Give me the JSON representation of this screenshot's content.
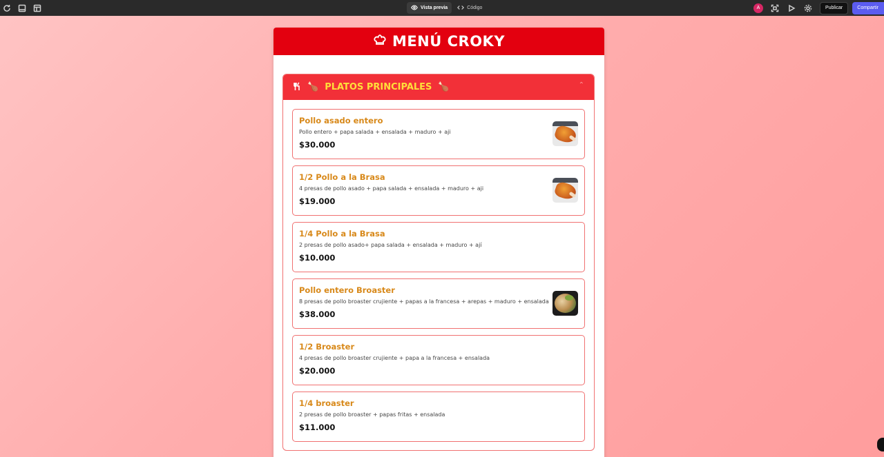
{
  "editor": {
    "tabs": [
      {
        "label": "Vista previa",
        "icon": "eye-icon"
      },
      {
        "label": "Código",
        "icon": "code-icon"
      }
    ],
    "avatar_initial": "A",
    "publish_label": "Publicar",
    "share_label": "Compartir"
  },
  "menu": {
    "title": "MENÚ CROKY",
    "section_title": "PLATOS PRINCIPALES",
    "colors": {
      "header": "#e3000f",
      "section_header": "#f23038",
      "section_title": "#ffdf3a",
      "item_name": "#d8891a",
      "item_border": "#f07070"
    },
    "items": [
      {
        "name": "Pollo asado entero",
        "desc": "Pollo entero + papa salada + ensalada + maduro + aji",
        "price": "$30.000",
        "image": "roast-chicken"
      },
      {
        "name": "1/2 Pollo a la Brasa",
        "desc": "4 presas de pollo asado + papa salada + ensalada + maduro + aji",
        "price": "$19.000",
        "image": "roast-chicken"
      },
      {
        "name": "1/4 Pollo a la Brasa",
        "desc": "2 presas de pollo asado+ papa salada + ensalada + maduro + ají",
        "price": "$10.000",
        "image": ""
      },
      {
        "name": "Pollo entero Broaster",
        "desc": "8 presas de pollo broaster crujiente + papas a la francesa + arepas + maduro + ensalada",
        "price": "$38.000",
        "image": "broaster-plate"
      },
      {
        "name": "1/2 Broaster",
        "desc": "4 presas de pollo broaster crujiente + papa a la francesa + ensalada",
        "price": "$20.000",
        "image": ""
      },
      {
        "name": "1/4 broaster",
        "desc": "2 presas de pollo broaster + papas fritas + ensalada",
        "price": "$11.000",
        "image": ""
      }
    ]
  }
}
